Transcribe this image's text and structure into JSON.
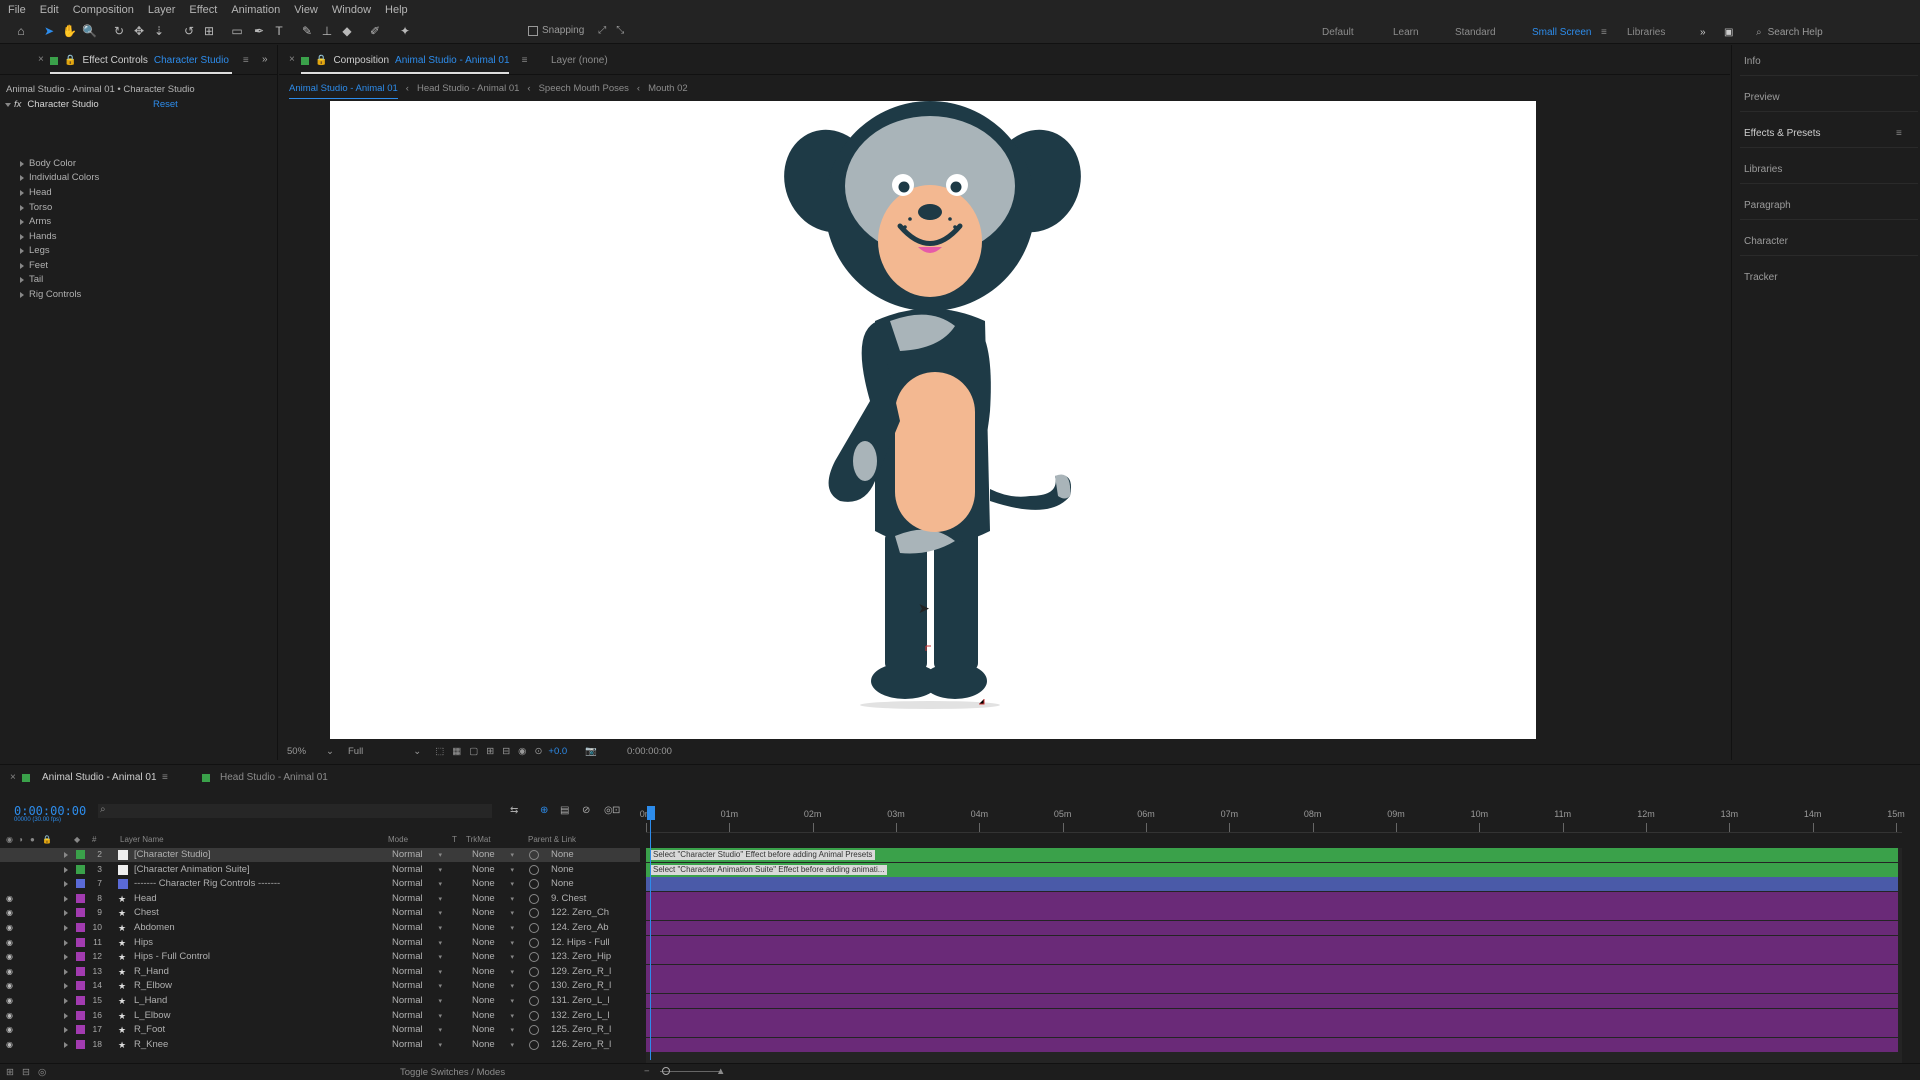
{
  "menu": [
    "File",
    "Edit",
    "Composition",
    "Layer",
    "Effect",
    "Animation",
    "View",
    "Window",
    "Help"
  ],
  "toolbar": {
    "snapping_label": "Snapping",
    "workspaces": [
      "Default",
      "Learn",
      "Standard",
      "Small Screen",
      "Libraries"
    ],
    "active_workspace": "Small Screen",
    "search_placeholder": "Search Help"
  },
  "effect_panel": {
    "tab_prefix": "Effect Controls",
    "tab_target": "Character Studio",
    "subtitle": "Animal Studio - Animal 01 • Character Studio",
    "effect_name": "Character Studio",
    "reset_label": "Reset",
    "properties": [
      "Body Color",
      "Individual Colors",
      "Head",
      "Torso",
      "Arms",
      "Hands",
      "Legs",
      "Feet",
      "Tail",
      "Rig Controls"
    ]
  },
  "comp_panel": {
    "tab_prefix": "Composition",
    "tab_target": "Animal Studio - Animal 01",
    "layer_tab": "Layer (none)",
    "flow_tabs": [
      "Animal Studio - Animal 01",
      "Head Studio - Animal 01",
      "Speech Mouth Poses",
      "Mouth 02"
    ],
    "zoom": "50%",
    "resolution": "Full",
    "exposure": "+0.0",
    "timecode": "0:00:00:00"
  },
  "right_panel": {
    "items": [
      "Info",
      "Preview",
      "Effects & Presets",
      "Libraries",
      "Paragraph",
      "Character",
      "Tracker"
    ]
  },
  "timeline": {
    "tabs": [
      "Animal Studio - Animal 01",
      "Head Studio - Animal 01"
    ],
    "timecode": "0:00:00:00",
    "timecode_sub": "00000 (30.00 fps)",
    "headers": {
      "layer_name": "Layer Name",
      "mode": "Mode",
      "t": "T",
      "trkmat": "TrkMat",
      "parent": "Parent & Link"
    },
    "ruler": [
      "0m",
      "01m",
      "02m",
      "03m",
      "04m",
      "05m",
      "06m",
      "07m",
      "08m",
      "09m",
      "10m",
      "11m",
      "12m",
      "13m",
      "14m",
      "15m"
    ],
    "layers": [
      {
        "num": "2",
        "name": "[Character Studio]",
        "mode": "Normal",
        "trkmat": "None",
        "parent": "None",
        "color": "#3aa14a",
        "selected": true,
        "icon": "solid"
      },
      {
        "num": "3",
        "name": "[Character Animation Suite]",
        "mode": "Normal",
        "trkmat": "None",
        "parent": "None",
        "color": "#3aa14a",
        "selected": false,
        "icon": "solid"
      },
      {
        "num": "7",
        "name": "------- Character Rig Controls -------",
        "mode": "Normal",
        "trkmat": "None",
        "parent": "None",
        "color": "#5a6ad6",
        "selected": false,
        "icon": "guide"
      },
      {
        "num": "8",
        "name": "Head",
        "mode": "Normal",
        "trkmat": "None",
        "parent": "9. Chest",
        "color": "#a23bb0",
        "selected": false,
        "icon": "shape"
      },
      {
        "num": "9",
        "name": "Chest",
        "mode": "Normal",
        "trkmat": "None",
        "parent": "122. Zero_Ch",
        "color": "#a23bb0",
        "selected": false,
        "icon": "shape"
      },
      {
        "num": "10",
        "name": "Abdomen",
        "mode": "Normal",
        "trkmat": "None",
        "parent": "124. Zero_Ab",
        "color": "#a23bb0",
        "selected": false,
        "icon": "shape"
      },
      {
        "num": "11",
        "name": "Hips",
        "mode": "Normal",
        "trkmat": "None",
        "parent": "12. Hips - Full",
        "color": "#a23bb0",
        "selected": false,
        "icon": "shape"
      },
      {
        "num": "12",
        "name": "Hips - Full Control",
        "mode": "Normal",
        "trkmat": "None",
        "parent": "123. Zero_Hip",
        "color": "#a23bb0",
        "selected": false,
        "icon": "shape"
      },
      {
        "num": "13",
        "name": "R_Hand",
        "mode": "Normal",
        "trkmat": "None",
        "parent": "129. Zero_R_l",
        "color": "#a23bb0",
        "selected": false,
        "icon": "shape"
      },
      {
        "num": "14",
        "name": "R_Elbow",
        "mode": "Normal",
        "trkmat": "None",
        "parent": "130. Zero_R_l",
        "color": "#a23bb0",
        "selected": false,
        "icon": "shape"
      },
      {
        "num": "15",
        "name": "L_Hand",
        "mode": "Normal",
        "trkmat": "None",
        "parent": "131. Zero_L_l",
        "color": "#a23bb0",
        "selected": false,
        "icon": "shape"
      },
      {
        "num": "16",
        "name": "L_Elbow",
        "mode": "Normal",
        "trkmat": "None",
        "parent": "132. Zero_L_l",
        "color": "#a23bb0",
        "selected": false,
        "icon": "shape"
      },
      {
        "num": "17",
        "name": "R_Foot",
        "mode": "Normal",
        "trkmat": "None",
        "parent": "125. Zero_R_l",
        "color": "#a23bb0",
        "selected": false,
        "icon": "shape"
      },
      {
        "num": "18",
        "name": "R_Knee",
        "mode": "Normal",
        "trkmat": "None",
        "parent": "126. Zero_R_l",
        "color": "#a23bb0",
        "selected": false,
        "icon": "shape"
      }
    ],
    "track_notes": [
      "Select \"Character Studio\" Effect before adding Animal Presets",
      "Select \"Character Animation Suite\" Effect before adding animati..."
    ],
    "toggle_label": "Toggle Switches / Modes"
  },
  "colors": {
    "accent": "#2d8ceb",
    "track_green": "#3aa14a",
    "track_blue": "#4a5aa8",
    "track_purple": "#6a2a78",
    "dog_dark": "#1e3a46",
    "dog_grey": "#a9b4b9",
    "dog_skin": "#f3b891"
  }
}
